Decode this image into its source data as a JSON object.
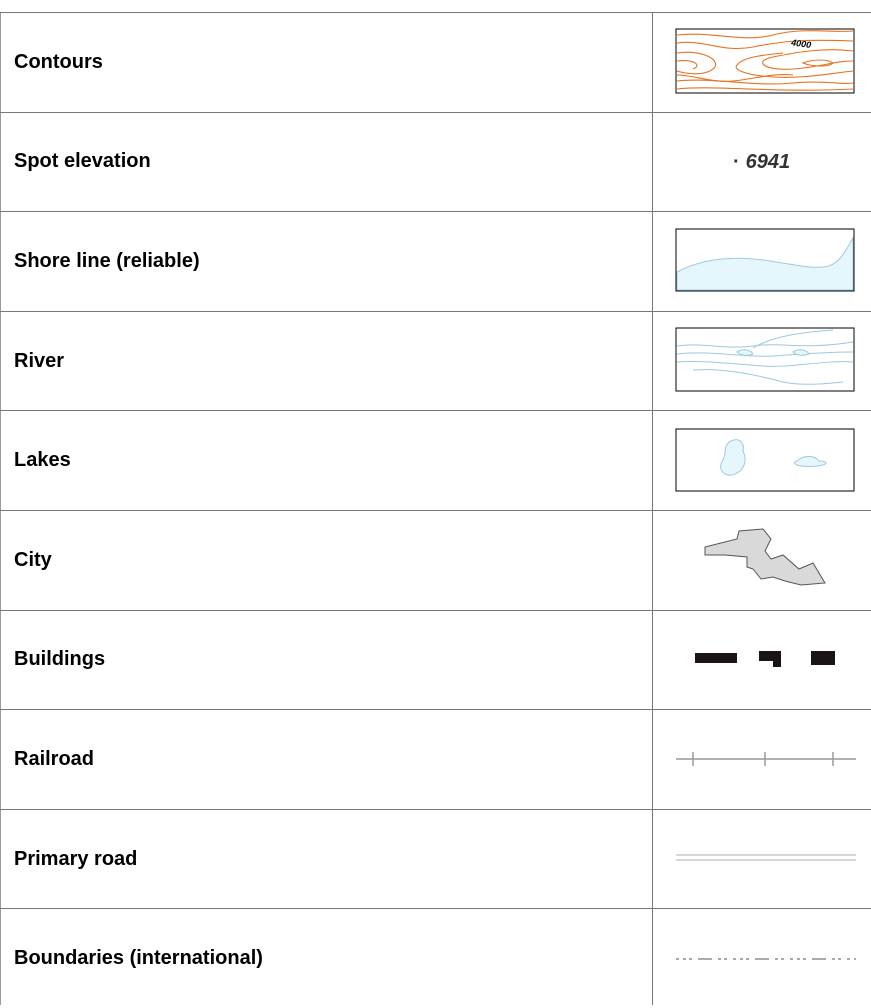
{
  "legend": {
    "rows": [
      {
        "label": "Contours",
        "symbol": "contours-icon"
      },
      {
        "label": "Spot elevation",
        "symbol": "spot-elevation-icon"
      },
      {
        "label": "Shore line (reliable)",
        "symbol": "shore-line-icon"
      },
      {
        "label": "River",
        "symbol": "river-icon"
      },
      {
        "label": "Lakes",
        "symbol": "lakes-icon"
      },
      {
        "label": "City",
        "symbol": "city-icon"
      },
      {
        "label": "Buildings",
        "symbol": "buildings-icon"
      },
      {
        "label": "Railroad",
        "symbol": "railroad-icon"
      },
      {
        "label": "Primary road",
        "symbol": "primary-road-icon"
      },
      {
        "label": "Boundaries (international)",
        "symbol": "boundary-icon"
      }
    ],
    "contour_label": "4000",
    "spot_value": "6941",
    "spot_dot": "·"
  },
  "colors": {
    "contour": "#e8711e",
    "water_fill": "#e6f7fb",
    "water_line": "#9ec8e0",
    "city_fill": "#d9d9d9",
    "building": "#1a1414",
    "rail": "#9a9a9a",
    "road": "#c8c8c8",
    "rule": "#777777"
  }
}
